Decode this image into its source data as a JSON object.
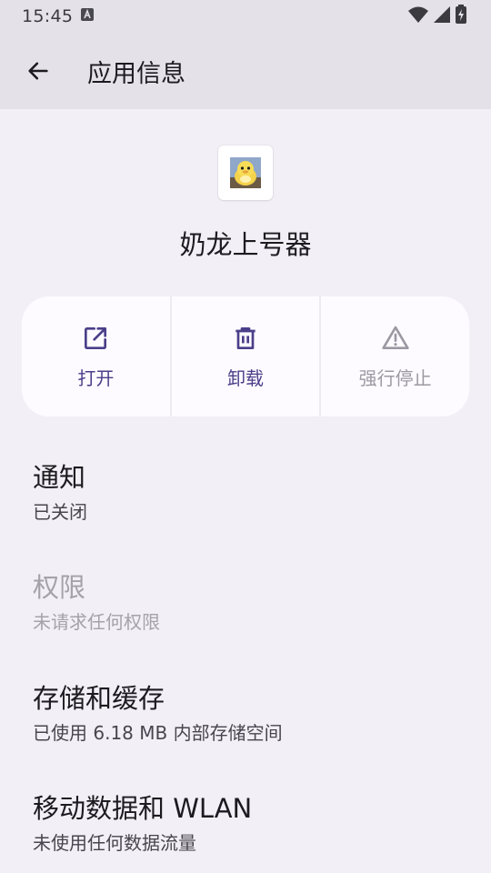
{
  "status_bar": {
    "time": "15:45"
  },
  "app_bar": {
    "title": "应用信息"
  },
  "app": {
    "name": "奶龙上号器"
  },
  "actions": [
    {
      "label": "打开",
      "icon": "open-external-icon",
      "enabled": true
    },
    {
      "label": "卸载",
      "icon": "trash-icon",
      "enabled": true
    },
    {
      "label": "强行停止",
      "icon": "warning-icon",
      "enabled": false
    }
  ],
  "settings": [
    {
      "title": "通知",
      "summary": "已关闭",
      "enabled": true
    },
    {
      "title": "权限",
      "summary": "未请求任何权限",
      "enabled": false
    },
    {
      "title": "存储和缓存",
      "summary": "已使用 6.18 MB 内部存储空间",
      "enabled": true
    },
    {
      "title": "移动数据和 WLAN",
      "summary": "未使用任何数据流量",
      "enabled": true
    }
  ],
  "colors": {
    "accent": "#4b3f8a",
    "background": "#f3eff6",
    "app_bar": "#e5e1e8",
    "card": "#fdfbff",
    "disabled": "#a5a2a9"
  }
}
